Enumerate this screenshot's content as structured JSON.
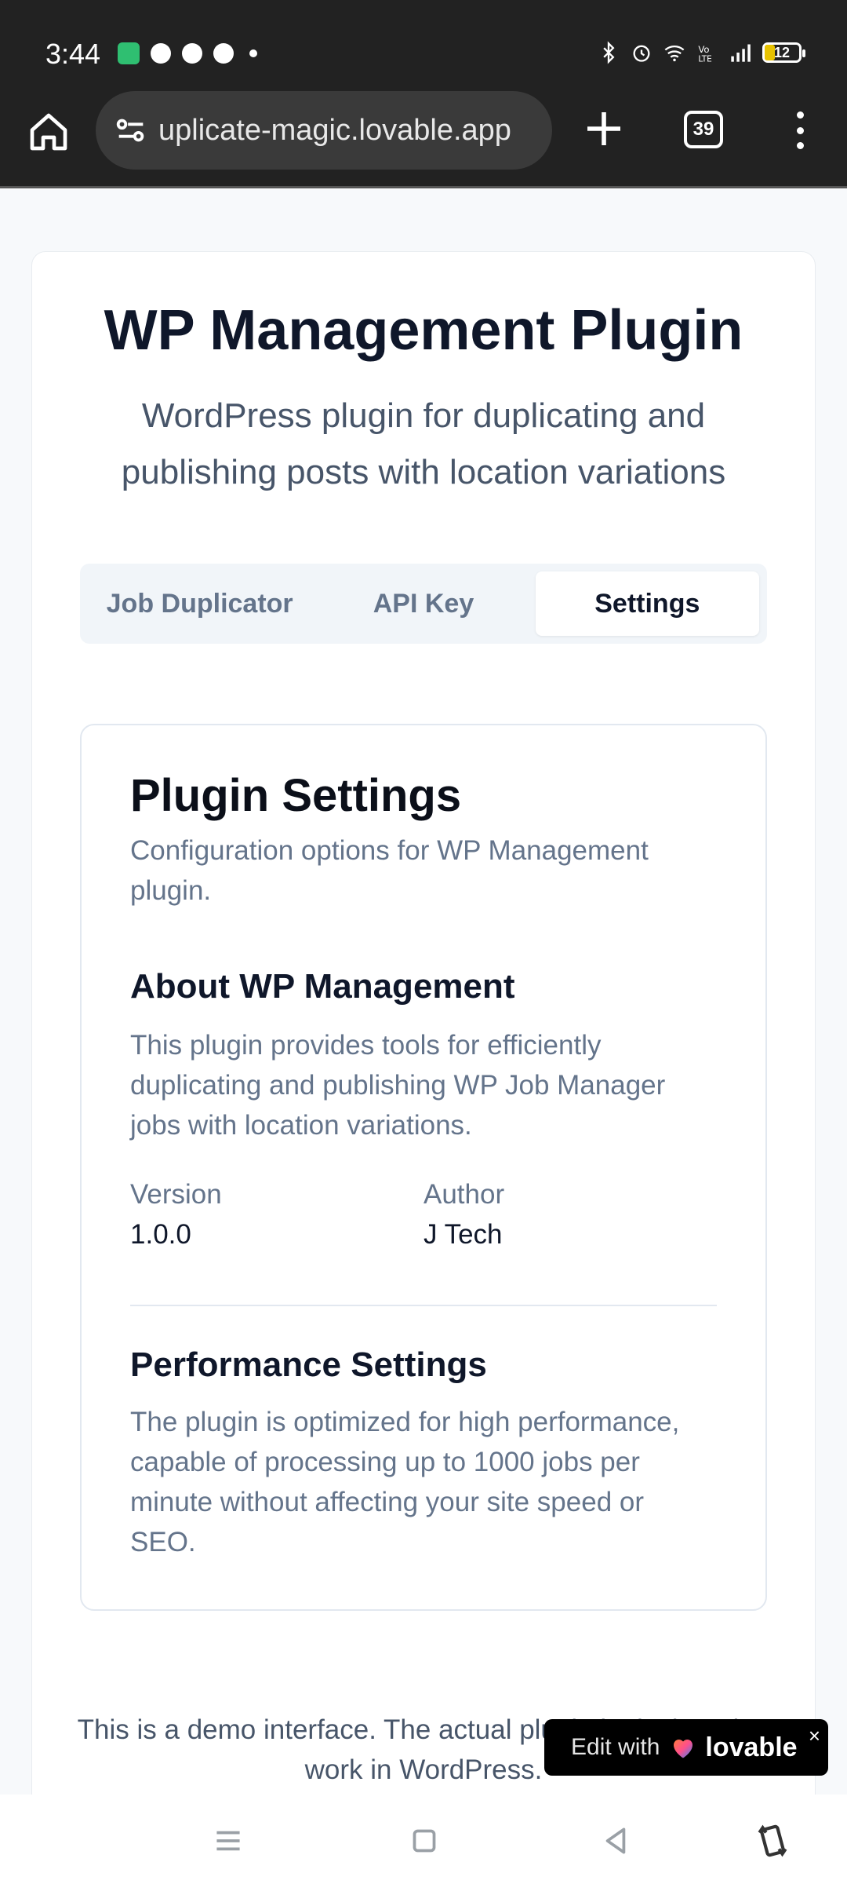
{
  "status_bar": {
    "time": "3:44",
    "battery": "12",
    "icons_left": [
      "app-icon",
      "chat-icon",
      "whatsapp-icon",
      "location-icon",
      "dot-icon"
    ],
    "icons_right": [
      "bluetooth-icon",
      "alarm-icon",
      "wifi-icon",
      "volte-icon",
      "signal-icon",
      "battery-icon"
    ]
  },
  "browser": {
    "url": "uplicate-magic.lovable.app",
    "tab_count": "39"
  },
  "header": {
    "title": "WP Management Plugin",
    "subtitle": "WordPress plugin for duplicating and publishing posts with location variations"
  },
  "tabs": [
    {
      "label": "Job Duplicator",
      "active": false
    },
    {
      "label": "API Key",
      "active": false
    },
    {
      "label": "Settings",
      "active": true
    }
  ],
  "settings": {
    "title": "Plugin Settings",
    "description": "Configuration options for WP Management plugin.",
    "about_heading": "About WP Management",
    "about_text": "This plugin provides tools for efficiently duplicating and publishing WP Job Manager jobs with location variations.",
    "version_label": "Version",
    "version_value": "1.0.0",
    "author_label": "Author",
    "author_value": "J Tech",
    "performance_heading": "Performance Settings",
    "performance_text": "The plugin is optimized for high performance, capable of processing up to 1000 jobs per minute without affecting your site speed or SEO."
  },
  "footer": {
    "text": "This is a demo interface. The actual plugin is designed to work in WordPress."
  },
  "badge": {
    "edit_label": "Edit with",
    "brand": "lovable",
    "close": "×"
  },
  "colors": {
    "accent": "#0f172a",
    "muted": "#64748b",
    "background": "#f7f9fb"
  }
}
